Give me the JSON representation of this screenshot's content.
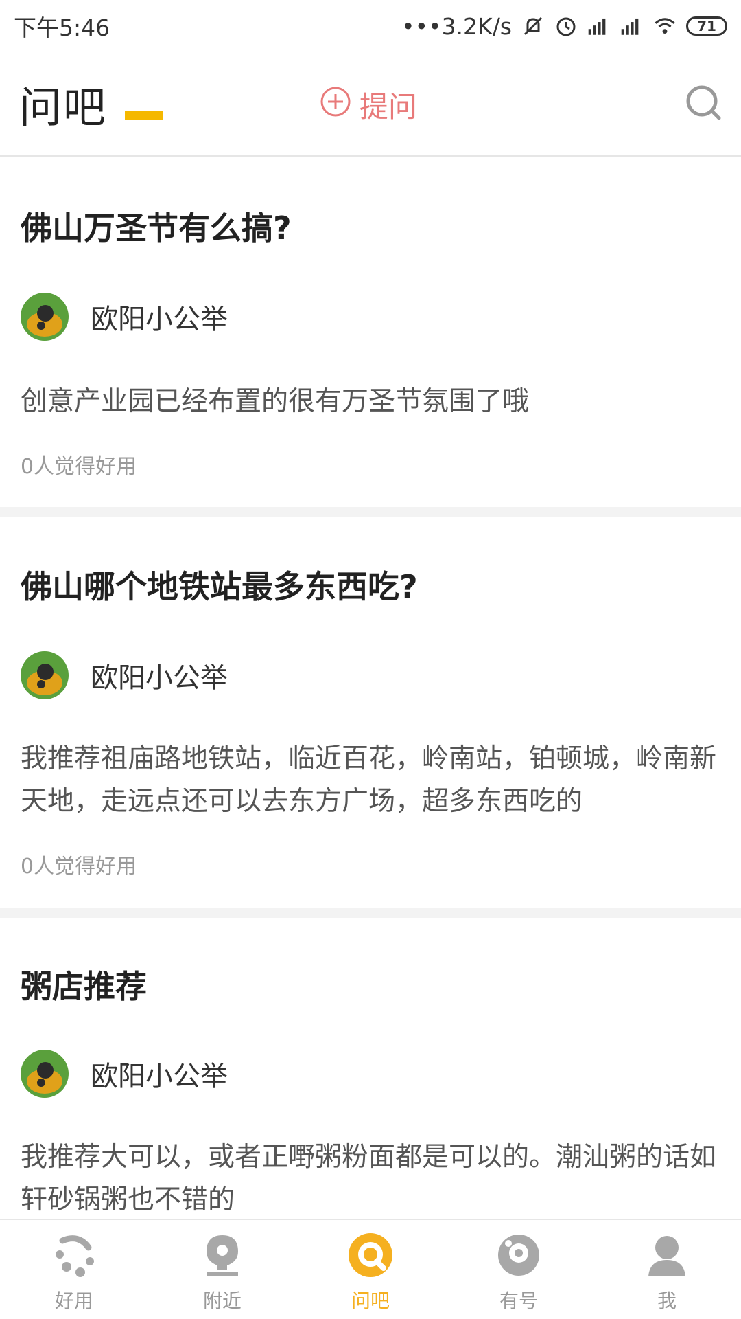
{
  "status_bar": {
    "time": "下午5:46",
    "network_speed": "•••3.2K/s",
    "battery": "71"
  },
  "header": {
    "title": "问吧",
    "ask_label": "提问"
  },
  "questions": [
    {
      "title": "佛山万圣节有么搞?",
      "author": "欧阳小公举",
      "answer": "创意产业园已经布置的很有万圣节氛围了哦",
      "useful": "0人觉得好用"
    },
    {
      "title": "佛山哪个地铁站最多东西吃?",
      "author": "欧阳小公举",
      "answer": "我推荐祖庙路地铁站，临近百花，岭南站，铂顿城，岭南新天地，走远点还可以去东方广场，超多东西吃的",
      "useful": "0人觉得好用"
    },
    {
      "title": "粥店推荐",
      "author": "欧阳小公举",
      "answer": "我推荐大可以，或者正嘢粥粉面都是可以的。潮汕粥的话如轩砂锅粥也不错的"
    }
  ],
  "bottom_nav": [
    {
      "label": "好用",
      "icon": "dots-curve-icon",
      "active": false
    },
    {
      "label": "附近",
      "icon": "location-pin-icon",
      "active": false
    },
    {
      "label": "问吧",
      "icon": "question-bubble-icon",
      "active": true
    },
    {
      "label": "有号",
      "icon": "smile-face-icon",
      "active": false
    },
    {
      "label": "我",
      "icon": "user-icon",
      "active": false
    }
  ],
  "colors": {
    "accent": "#f5b020",
    "ask_red": "#e87a7a",
    "divider": "#f3f3f3"
  }
}
